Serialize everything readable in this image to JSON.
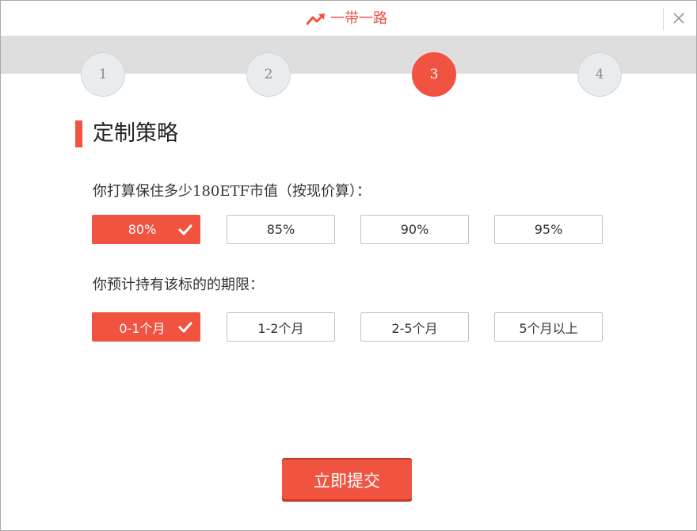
{
  "window": {
    "title": "一带一路",
    "title_icon": "trend-up-icon",
    "close_icon": "close-icon",
    "accent_color": "#f05441"
  },
  "steps": {
    "items": [
      "1",
      "2",
      "3",
      "4"
    ],
    "active_index": 2
  },
  "section": {
    "title": "定制策略"
  },
  "question1": {
    "text": "你打算保住多少180ETF市值（按现价算）：",
    "options": [
      "80%",
      "85%",
      "90%",
      "95%"
    ],
    "selected_index": 0
  },
  "question2": {
    "text": "你预计持有该标的的期限：",
    "options": [
      "0-1个月",
      "1-2个月",
      "2-5个月",
      "5个月以上"
    ],
    "selected_index": 0
  },
  "submit": {
    "label": "立即提交"
  }
}
